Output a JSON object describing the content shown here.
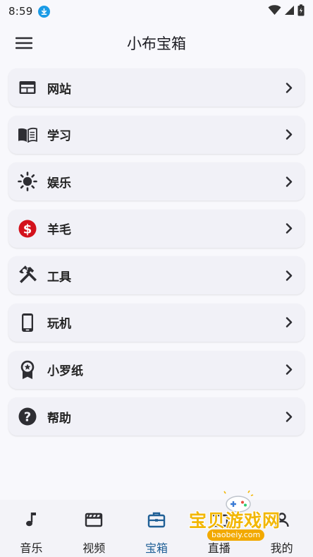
{
  "status_bar": {
    "time": "8:59",
    "icons": [
      "download-icon",
      "wifi-icon",
      "cellular-signal-icon",
      "battery-charging-icon"
    ],
    "accent": "#1a9be6"
  },
  "app_bar": {
    "title": "小布宝箱",
    "menu_icon": "hamburger-menu-icon"
  },
  "menu_items": [
    {
      "label": "网站",
      "icon": "browser-window-icon",
      "id": "website"
    },
    {
      "label": "学习",
      "icon": "open-book-icon",
      "id": "study"
    },
    {
      "label": "娱乐",
      "icon": "sun-icon",
      "id": "entertainment"
    },
    {
      "label": "羊毛",
      "icon": "dollar-coin-icon",
      "id": "deals",
      "icon_color": "#d3121c"
    },
    {
      "label": "工具",
      "icon": "hammer-wrench-icon",
      "id": "tools"
    },
    {
      "label": "玩机",
      "icon": "smartphone-icon",
      "id": "phone"
    },
    {
      "label": "小罗纸",
      "icon": "award-badge-icon",
      "id": "xiaoluozhi"
    },
    {
      "label": "帮助",
      "icon": "help-circle-icon",
      "id": "help"
    }
  ],
  "bottom_nav": {
    "items": [
      {
        "label": "音乐",
        "icon": "music-note-icon",
        "active": false
      },
      {
        "label": "视频",
        "icon": "film-clapper-icon",
        "active": false
      },
      {
        "label": "宝箱",
        "icon": "briefcase-icon",
        "active": true
      },
      {
        "label": "直播",
        "icon": "tv-icon",
        "active": false
      },
      {
        "label": "我的",
        "icon": "person-icon",
        "active": false
      }
    ],
    "active_color": "#1f5f96"
  },
  "watermark": {
    "text": "宝贝游戏网",
    "url": "baobeiy.com"
  },
  "colors": {
    "background": "#f8f8fc",
    "card": "#f1f1f7",
    "icon": "#2e2e33"
  }
}
